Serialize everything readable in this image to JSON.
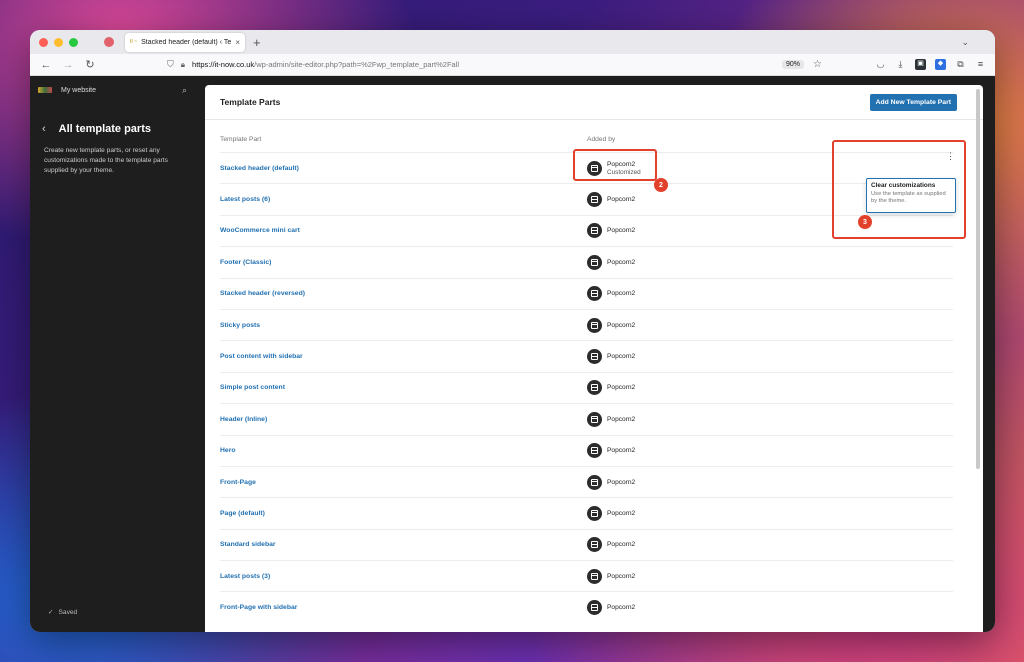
{
  "browser": {
    "tab_title": "Stacked header (default) ‹ Tem",
    "tab_favicon_text": "II ~",
    "tab_close": "×",
    "new_tab": "+",
    "url_host": "https://it-now.co.uk",
    "url_path": "/wp-admin/site-editor.php?path=%2Fwp_template_part%2Fall",
    "zoom": "90%"
  },
  "sidebar": {
    "site_name": "My website",
    "heading": "All template parts",
    "description": "Create new template parts, or reset any customizations made to the template parts supplied by your theme.",
    "saved": "Saved"
  },
  "main": {
    "title": "Template Parts",
    "add_button": "Add New Template Part",
    "col_part": "Template Part",
    "col_added": "Added by",
    "rows": [
      {
        "name": "Stacked header (default)",
        "by": "Popcorn2",
        "sub": "Customized"
      },
      {
        "name": "Latest posts (6)",
        "by": "Popcorn2",
        "sub": ""
      },
      {
        "name": "WooCommerce mini cart",
        "by": "Popcorn2",
        "sub": ""
      },
      {
        "name": "Footer (Classic)",
        "by": "Popcorn2",
        "sub": ""
      },
      {
        "name": "Stacked header (reversed)",
        "by": "Popcorn2",
        "sub": ""
      },
      {
        "name": "Sticky posts",
        "by": "Popcorn2",
        "sub": ""
      },
      {
        "name": "Post content with sidebar",
        "by": "Popcorn2",
        "sub": ""
      },
      {
        "name": "Simple post content",
        "by": "Popcorn2",
        "sub": ""
      },
      {
        "name": "Header (Inline)",
        "by": "Popcorn2",
        "sub": ""
      },
      {
        "name": "Hero",
        "by": "Popcorn2",
        "sub": ""
      },
      {
        "name": "Front-Page",
        "by": "Popcorn2",
        "sub": ""
      },
      {
        "name": "Page (default)",
        "by": "Popcorn2",
        "sub": ""
      },
      {
        "name": "Standard sidebar",
        "by": "Popcorn2",
        "sub": ""
      },
      {
        "name": "Latest posts (3)",
        "by": "Popcorn2",
        "sub": ""
      },
      {
        "name": "Front-Page with sidebar",
        "by": "Popcorn2",
        "sub": ""
      }
    ],
    "popover_title": "Clear customizations",
    "popover_desc": "Use the template as supplied by the theme."
  },
  "annotations": {
    "badge_2": "2",
    "badge_3": "3",
    "highlight_color": "#e2422b"
  },
  "colors": {
    "accent": "#2271b1",
    "sidebar_bg": "#1e1e1e"
  }
}
